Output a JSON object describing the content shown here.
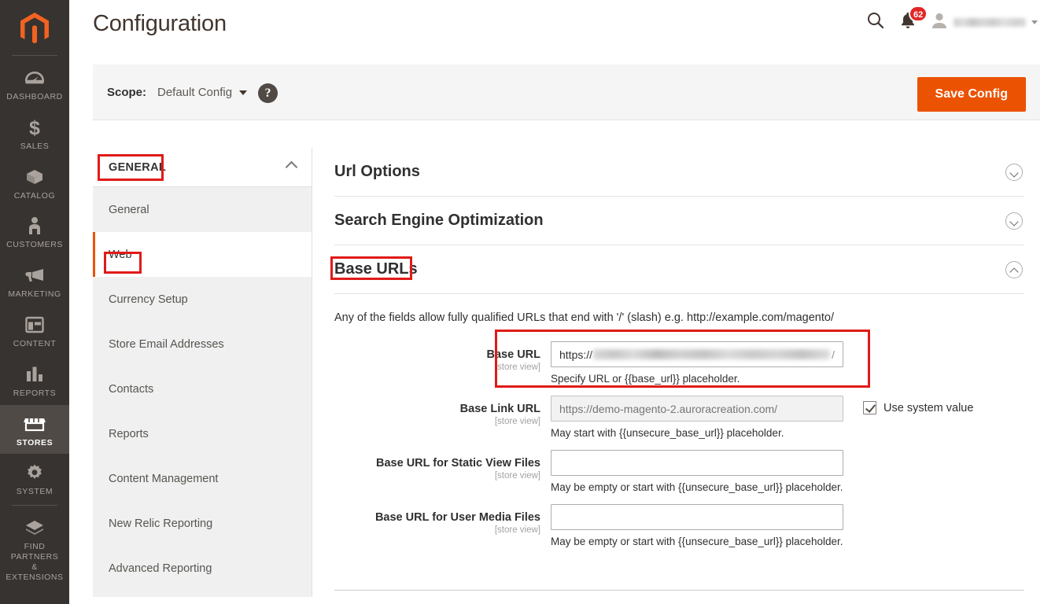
{
  "admin_rail": {
    "logo_name": "magento-logo",
    "items": [
      {
        "label": "Dashboard",
        "icon": "dashboard-gauge-icon",
        "active": false
      },
      {
        "label": "Sales",
        "icon": "dollar-sign-icon",
        "active": false
      },
      {
        "label": "Catalog",
        "icon": "box-icon",
        "active": false
      },
      {
        "label": "Customers",
        "icon": "person-icon",
        "active": false
      },
      {
        "label": "Marketing",
        "icon": "megaphone-icon",
        "active": false
      },
      {
        "label": "Content",
        "icon": "layout-window-icon",
        "active": false
      },
      {
        "label": "Reports",
        "icon": "bar-chart-icon",
        "active": false
      },
      {
        "label": "Stores",
        "icon": "storefront-icon",
        "active": true
      },
      {
        "label": "System",
        "icon": "gear-icon",
        "active": false
      },
      {
        "label": "Find Partners\n& Extensions",
        "icon": "extension-block-icon",
        "active": false
      }
    ]
  },
  "header": {
    "title": "Configuration",
    "search_icon": "search-icon",
    "notifications": {
      "icon": "bell-icon",
      "count": "62"
    },
    "user": {
      "avatar_icon": "user-avatar-icon",
      "name_masked": true,
      "caret_icon": "chevron-down-icon"
    }
  },
  "scope_bar": {
    "label": "Scope:",
    "selected": "Default Config",
    "caret_icon": "chevron-down-icon",
    "help_icon": "question-mark-icon",
    "help_glyph": "?",
    "save_button": "Save Config",
    "save_button_color": "#eb5202"
  },
  "config_nav": {
    "group_title": "GENERAL",
    "group_chevron_icon": "chevron-up-icon",
    "items": [
      {
        "label": "General",
        "active": false
      },
      {
        "label": "Web",
        "active": true
      },
      {
        "label": "Currency Setup",
        "active": false
      },
      {
        "label": "Store Email Addresses",
        "active": false
      },
      {
        "label": "Contacts",
        "active": false
      },
      {
        "label": "Reports",
        "active": false
      },
      {
        "label": "Content Management",
        "active": false
      },
      {
        "label": "New Relic Reporting",
        "active": false
      },
      {
        "label": "Advanced Reporting",
        "active": false
      }
    ]
  },
  "sections": [
    {
      "title": "Url Options",
      "expanded": false,
      "chevron_icon": "chevron-down-circle-icon"
    },
    {
      "title": "Search Engine Optimization",
      "expanded": false,
      "chevron_icon": "chevron-down-circle-icon"
    },
    {
      "title": "Base URLs",
      "expanded": true,
      "chevron_icon": "chevron-up-circle-icon"
    }
  ],
  "base_urls": {
    "intro": "Any of the fields allow fully qualified URLs that end with '/' (slash) e.g. http://example.com/magento/",
    "fields": [
      {
        "label": "Base URL",
        "scope": "[store view]",
        "value_prefix": "https://",
        "value_masked": true,
        "value_tail": "/",
        "placeholder": "",
        "note": "Specify URL or {{base_url}} placeholder.",
        "disabled": false,
        "use_system_value": null,
        "use_system_value_label": ""
      },
      {
        "label": "Base Link URL",
        "scope": "[store view]",
        "value_prefix": "",
        "value_masked": false,
        "value_tail": "",
        "placeholder": "https://demo-magento-2.auroracreation.com/",
        "note": "May start with {{unsecure_base_url}} placeholder.",
        "disabled": true,
        "use_system_value": true,
        "use_system_value_label": "Use system value"
      },
      {
        "label": "Base URL for Static View Files",
        "scope": "[store view]",
        "value_prefix": "",
        "value_masked": false,
        "value_tail": "",
        "placeholder": "",
        "note": "May be empty or start with {{unsecure_base_url}} placeholder.",
        "disabled": false,
        "use_system_value": null,
        "use_system_value_label": ""
      },
      {
        "label": "Base URL for User Media Files",
        "scope": "[store view]",
        "value_prefix": "",
        "value_masked": false,
        "value_tail": "",
        "placeholder": "",
        "note": "May be empty or start with {{unsecure_base_url}} placeholder.",
        "disabled": false,
        "use_system_value": null,
        "use_system_value_label": ""
      }
    ]
  },
  "annotations": {
    "color": "#e01b18",
    "boxes": [
      {
        "name": "general-group-highlight",
        "target": "GENERAL"
      },
      {
        "name": "web-item-highlight",
        "target": "Web"
      },
      {
        "name": "base-urls-section-highlight",
        "target": "Base URLs"
      },
      {
        "name": "base-url-field-highlight",
        "target": "Base URL"
      }
    ]
  }
}
